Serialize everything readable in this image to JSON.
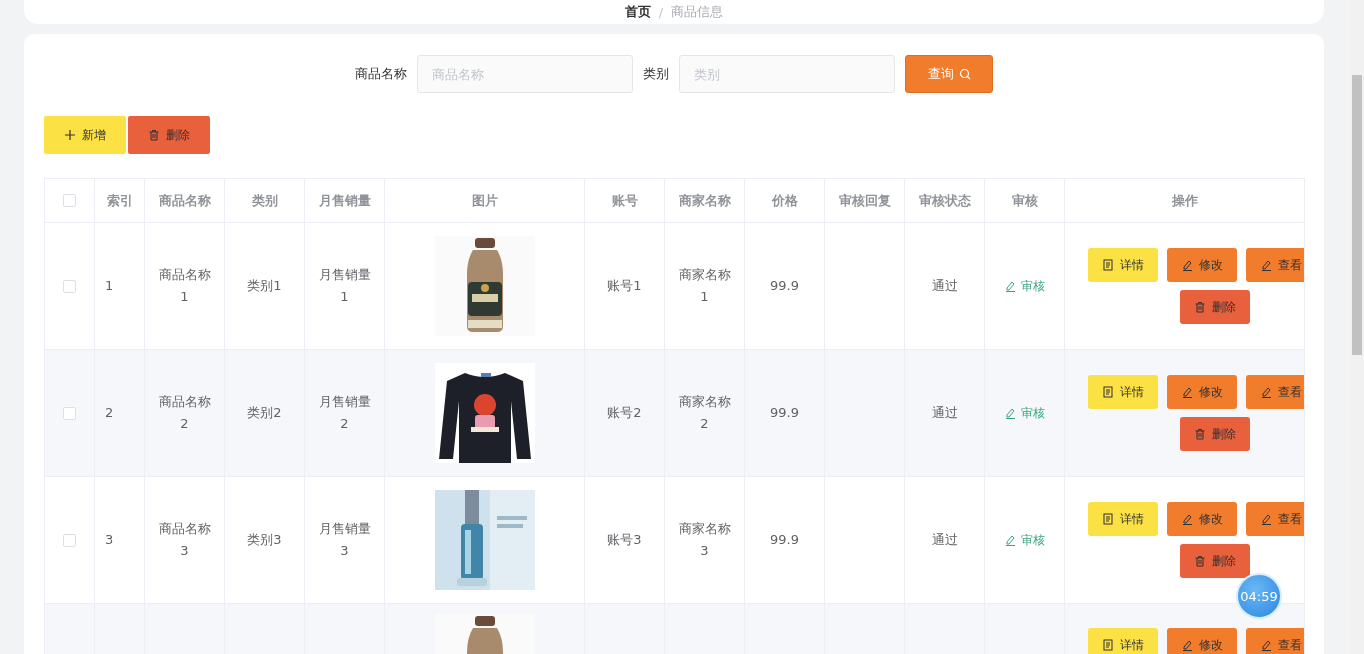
{
  "breadcrumb": {
    "items": [
      "首页",
      "商品信息"
    ],
    "separator": "/"
  },
  "search": {
    "fields": [
      {
        "label": "商品名称",
        "placeholder": "商品名称"
      },
      {
        "label": "类别",
        "placeholder": "类别"
      }
    ],
    "button": "查询"
  },
  "toolbar": {
    "add": "新增",
    "delete": "删除"
  },
  "table": {
    "all_checked": false,
    "columns": [
      "索引",
      "商品名称",
      "类别",
      "月售销量",
      "图片",
      "账号",
      "商家名称",
      "价格",
      "审核回复",
      "审核状态",
      "审核",
      "操作"
    ],
    "rows": [
      {
        "kind": "full",
        "checked": false,
        "cells": [
          "1",
          "商品名称1",
          "类别1",
          "月售销量1",
          "账号1",
          "商家名称1",
          "99.9",
          "",
          "通过"
        ],
        "review": "审核",
        "actions": [
          "详情",
          "修改",
          "查看"
        ],
        "delete": "删除"
      },
      {
        "kind": "full",
        "checked": false,
        "cells": [
          "2",
          "商品名称2",
          "类别2",
          "月售销量2",
          "账号2",
          "商家名称2",
          "99.9",
          "",
          "通过"
        ],
        "review": "审核",
        "actions": [
          "详情",
          "修改",
          "查看"
        ],
        "delete": "删除"
      },
      {
        "kind": "full",
        "checked": false,
        "cells": [
          "3",
          "商品名称3",
          "类别3",
          "月售销量3",
          "账号3",
          "商家名称3",
          "99.9",
          "",
          "通过"
        ],
        "review": "审核",
        "actions": [
          "详情",
          "修改",
          "查看"
        ],
        "delete": "删除"
      },
      {
        "kind": "partial",
        "actions": [
          "详情",
          "修改",
          "查看"
        ]
      }
    ]
  },
  "timer": "04:59"
}
